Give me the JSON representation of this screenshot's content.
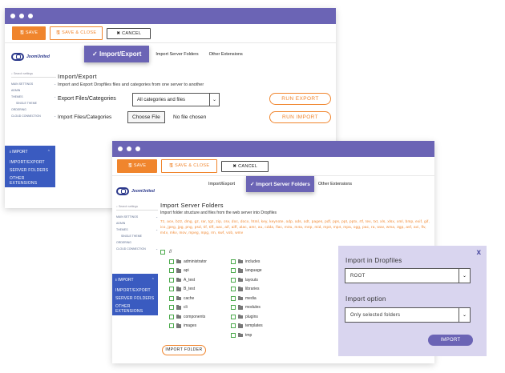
{
  "toolbar": {
    "save_label": "SAVE",
    "save_close_label": "SAVE & CLOSE",
    "cancel_label": "CANCEL"
  },
  "logo": {
    "text": "JoomUnited"
  },
  "sidebar": {
    "search_placeholder": "Search settings",
    "items_w1": [
      "MAIN SETTINGS",
      "ADMIN",
      "THEMES",
      "SINGLE THEME",
      "ORDERING",
      "CLOUD CONNECTION"
    ],
    "items_w2": [
      "MAIN SETTINGS",
      "ADMIN",
      "THEMES",
      "SINGLE THEME",
      "ORDERING",
      "CLOUD CONNECTION"
    ],
    "import_label": "IMPORT",
    "import_items": [
      "IMPORT/EXPORT",
      "SERVER FOLDERS",
      "OTHER EXTENSIONS"
    ]
  },
  "tabs": {
    "import_export": "Import/Export",
    "server_folders": "Import Server Folders",
    "other_ext": "Other Extensions"
  },
  "win1": {
    "heading": "Import/Export",
    "desc": "Import and Export Dropfiles files and categories from one server to another",
    "export_label": "Export Files/Categories",
    "export_select": "All categories and files",
    "import_label": "Import Files/Categories",
    "choose_file": "Choose File",
    "no_file": "No file chosen",
    "run_export": "RUN EXPORT",
    "run_import": "RUN IMPORT"
  },
  "win2": {
    "heading": "Import Server Folders",
    "desc": "Import folder structure and files from the web server into Dropfiles",
    "extensions": "7z, ace, bz2, dmg, gz, rar, tgz, zip, csv, doc, docx, html, key, keynote, odp, ods, odt, pages, pdf, pps, ppt, pptx, rtf, tex, txt, xls, xlsx, xml, bmp, exif, gif, ico, jpeg, jpg, png, psd, tif, tiff, aac, aif, aiff, alac, amr, au, cdda, flac, m3u, m4a, m4p, mid, mp3, mp4, mpa, ogg, pac, ra, wav, wma, 3gp, asf, avi, flv, m4v, mkv, mov, mpeg, mpg, rm, swf, vob, wmv",
    "root": "//",
    "folders_col1": [
      "administrator",
      "api",
      "A_test",
      "B_test",
      "cache",
      "cli",
      "components",
      "images"
    ],
    "folders_col2": [
      "includes",
      "language",
      "layouts",
      "libraries",
      "media",
      "modules",
      "plugins",
      "templates",
      "tmp"
    ],
    "import_folder_btn": "IMPORT FOLDER"
  },
  "panel": {
    "close": "x",
    "title": "Import in Dropfiles",
    "root_value": "ROOT",
    "option_label": "Import option",
    "option_value": "Only selected folders",
    "import_btn": "IMPORT"
  },
  "colors": {
    "accent_purple": "#6b64b5",
    "accent_orange": "#f0852d",
    "sidebar_blue": "#3a5bc0",
    "panel_bg": "#d9d5ef"
  }
}
